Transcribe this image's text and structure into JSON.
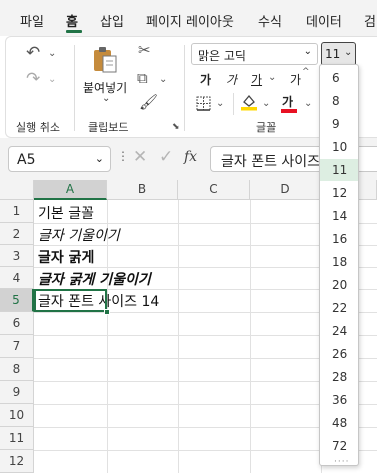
{
  "tabs": {
    "file": "파일",
    "home": "홈",
    "insert": "삽입",
    "page_layout": "페이지 레이아웃",
    "formulas": "수식",
    "data": "데이터",
    "review_partial": "검"
  },
  "ribbon": {
    "undo_group_label": "실행 취소",
    "paste_label": "붙여넣기",
    "clipboard_group_label": "클립보드",
    "font_group_label": "글꼴",
    "font_name": "맑은 고딕",
    "font_size": "11",
    "bold_glyph": "가",
    "italic_glyph": "가",
    "underline_glyph": "가",
    "increase_size_glyph": "가",
    "font_color_glyph": "가",
    "font_color": "#e81123",
    "highlight_color": "#ffd800"
  },
  "formula_bar": {
    "cell_ref": "A5",
    "fx_label": "fx",
    "content": "글자 폰트 사이즈 14"
  },
  "grid": {
    "columns": [
      "A",
      "B",
      "C",
      "D"
    ],
    "rows": [
      "1",
      "2",
      "3",
      "4",
      "5",
      "6",
      "7",
      "8",
      "9",
      "10",
      "11",
      "12",
      "13"
    ],
    "selected_column": "A",
    "selected_row": "5",
    "cells": {
      "A1": "기본 글꼴",
      "A2": "글자 기울이기",
      "A3": "글자 굵게",
      "A4": "글자 굵게 기울이기",
      "A5": "글자 폰트 사이즈 14"
    },
    "accent_color": "#217346"
  },
  "font_size_dropdown": {
    "options": [
      "6",
      "8",
      "9",
      "10",
      "11",
      "12",
      "14",
      "16",
      "18",
      "20",
      "22",
      "24",
      "26",
      "28",
      "36",
      "48",
      "72"
    ],
    "selected": "11"
  }
}
